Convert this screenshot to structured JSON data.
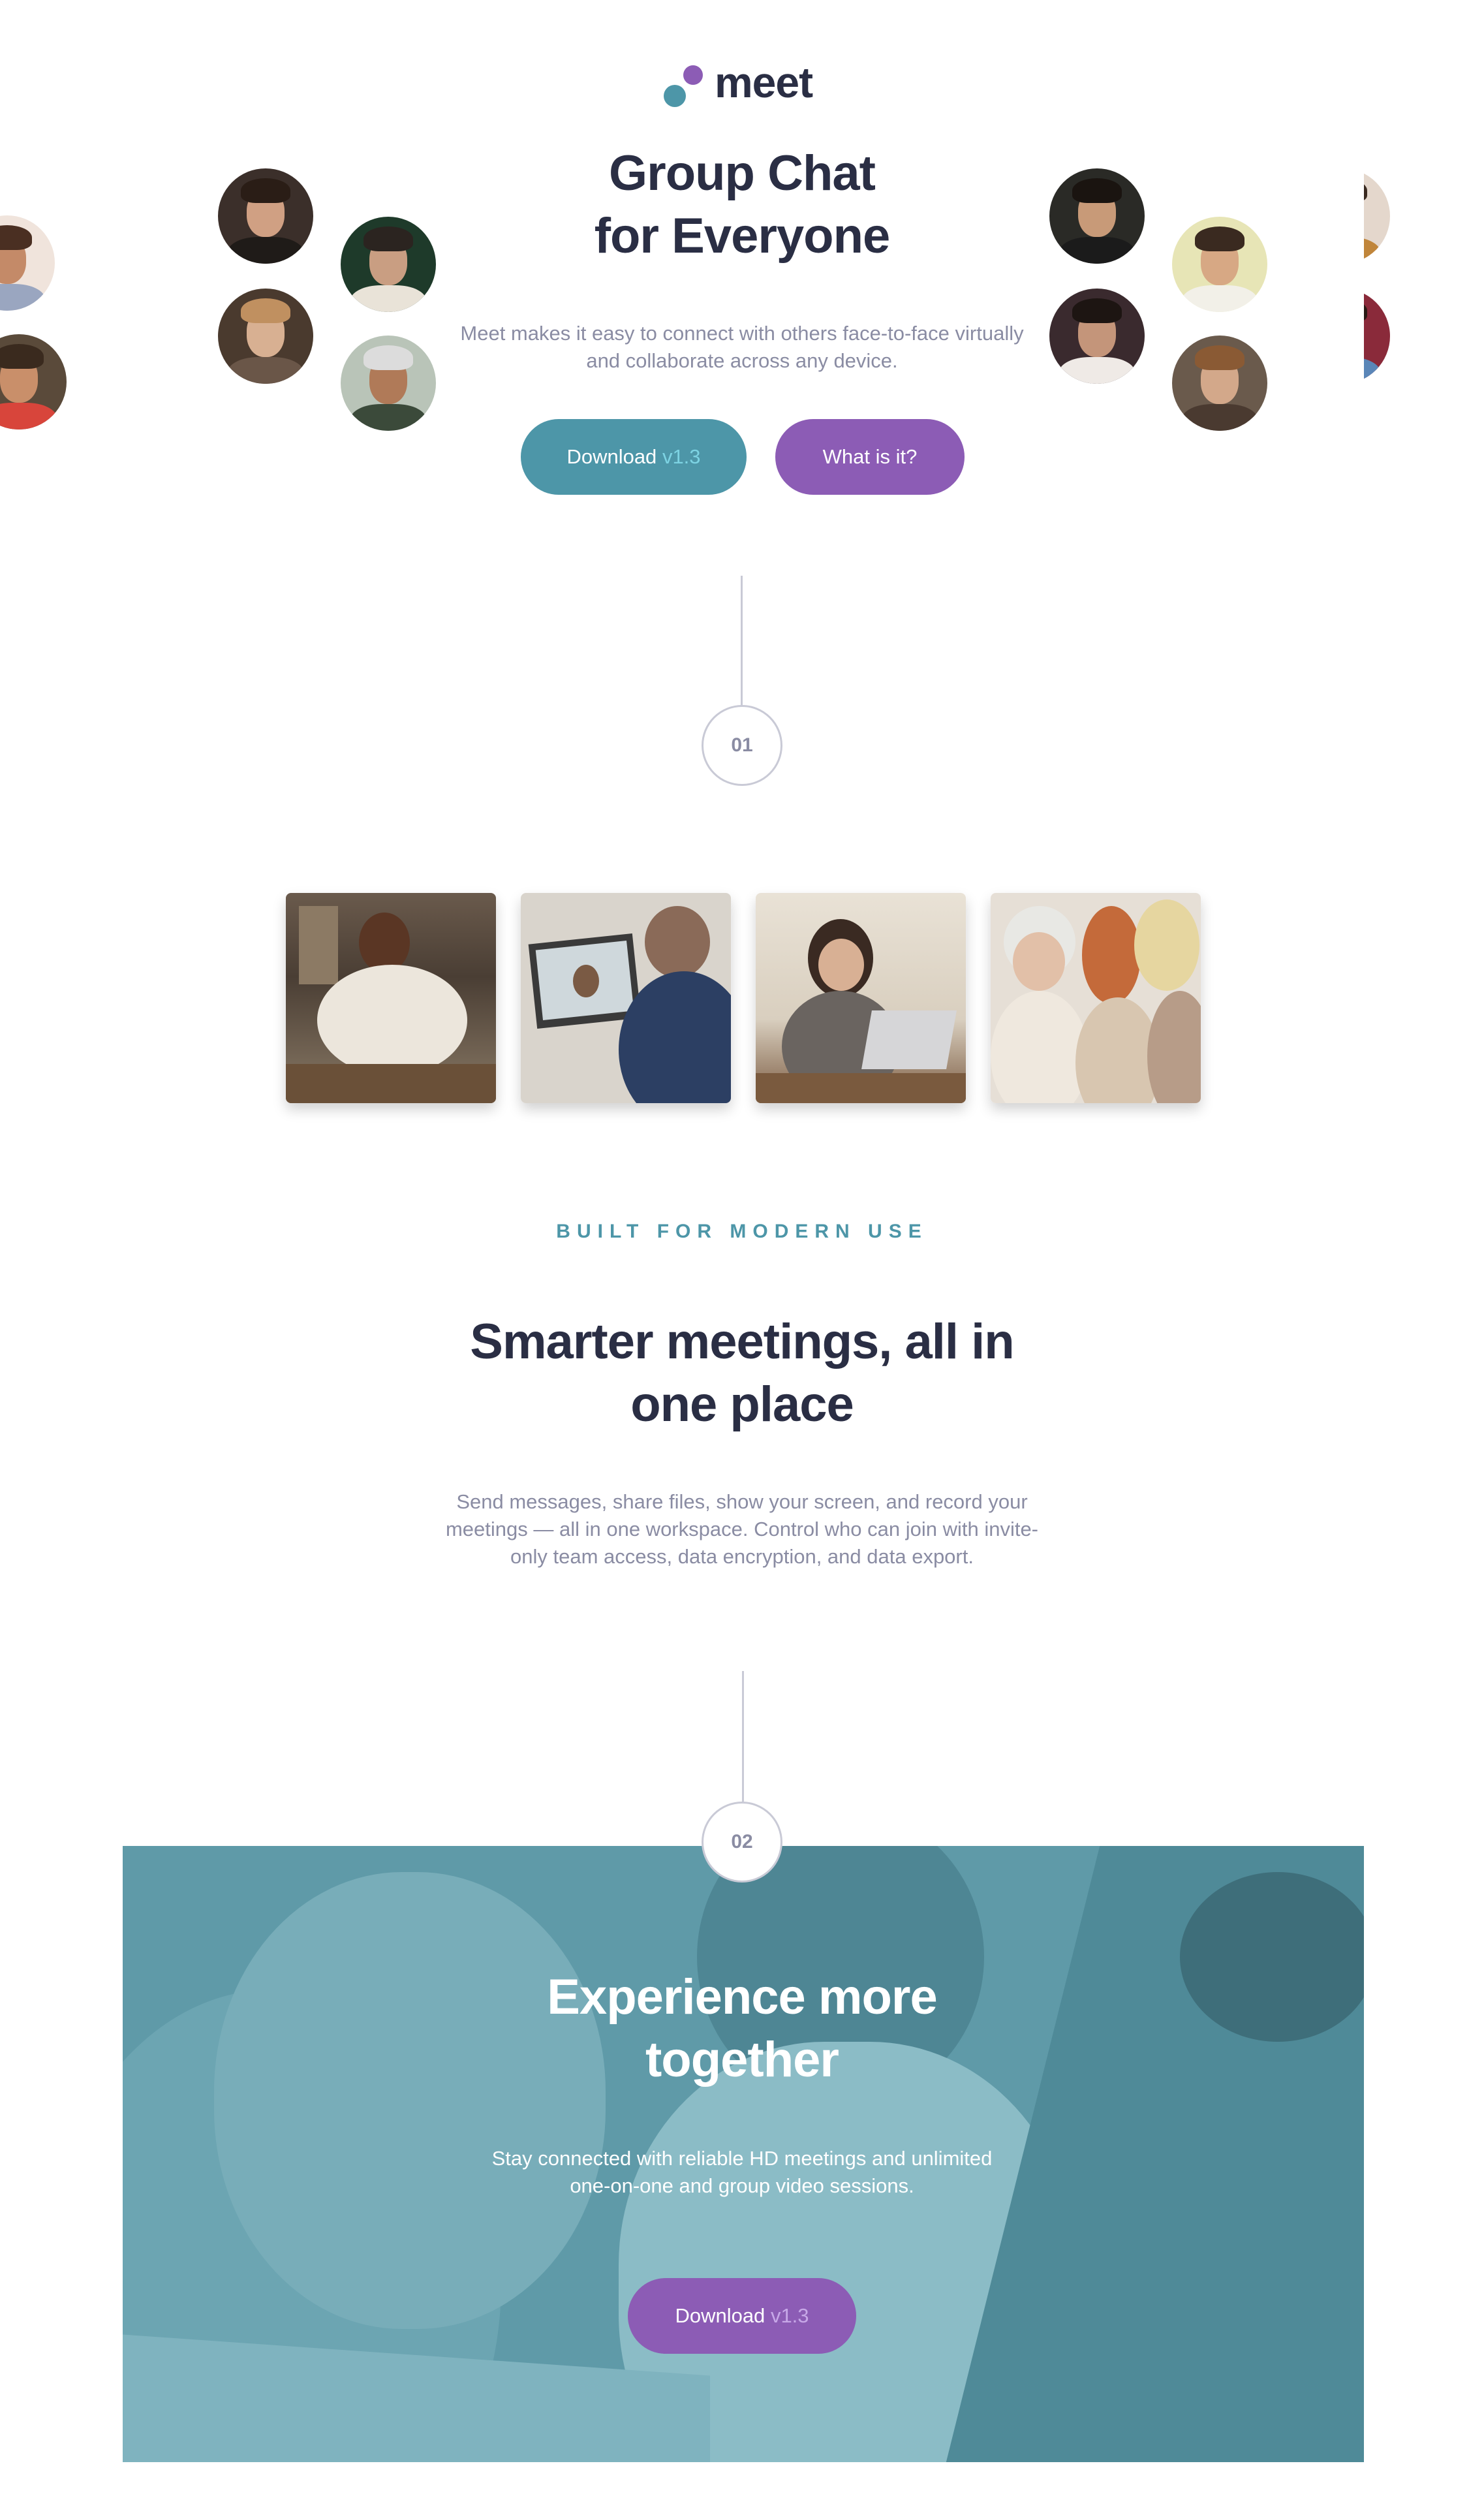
{
  "brand": {
    "name": "meet",
    "teal": "#4d96a8",
    "purple": "#8c5cb5",
    "dark": "#2a2e44"
  },
  "hero": {
    "title_line1": "Group Chat",
    "title_line2": "for Everyone",
    "subtitle": "Meet makes it easy to connect with others face-to-face virtually and collaborate across any device.",
    "download_label": "Download",
    "download_version": "v1.3",
    "what_label": "What is it?"
  },
  "steps": {
    "one": "01",
    "two": "02"
  },
  "gallery": {
    "photos": [
      "man-using-phone",
      "video-call-on-laptop",
      "woman-at-laptop",
      "friends-looking-at-phone"
    ]
  },
  "features": {
    "eyebrow": "BUILT FOR MODERN USE",
    "title_line1": "Smarter meetings, all in",
    "title_line2": "one place",
    "body": "Send messages, share files, show your screen, and record your meetings — all in one workspace. Control who can join with invite-only team access, data encryption, and data export."
  },
  "experience": {
    "title_line1": "Experience more",
    "title_line2": "together",
    "body": "Stay connected with reliable HD meetings and unlimited one-on-one and group video sessions.",
    "download_label": "Download",
    "download_version": "v1.3"
  }
}
